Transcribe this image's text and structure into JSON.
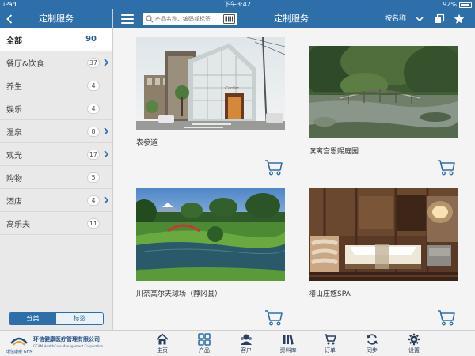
{
  "status": {
    "device": "iPad",
    "time": "下午3:42",
    "battery": "92%",
    "battery_level": 0.92
  },
  "sidebar": {
    "title": "定制服务",
    "categories": [
      {
        "label": "全部",
        "count": "90",
        "active": true,
        "has_arrow": false
      },
      {
        "label": "餐厅&饮食",
        "count": "37",
        "has_arrow": true
      },
      {
        "label": "养生",
        "count": "4",
        "has_arrow": false
      },
      {
        "label": "娱乐",
        "count": "4",
        "has_arrow": false
      },
      {
        "label": "温泉",
        "count": "8",
        "has_arrow": true
      },
      {
        "label": "观光",
        "count": "17",
        "has_arrow": true
      },
      {
        "label": "购物",
        "count": "5",
        "has_arrow": false
      },
      {
        "label": "酒店",
        "count": "4",
        "has_arrow": true
      },
      {
        "label": "高乐夫",
        "count": "11",
        "has_arrow": false
      }
    ],
    "segment": {
      "left": "分类",
      "right": "标签"
    }
  },
  "header": {
    "title": "定制服务",
    "search_placeholder": "产品名称、编码或标签",
    "sort_label": "按名称"
  },
  "products": [
    {
      "name": "表参道",
      "image": "building-photo"
    },
    {
      "name": "滨离宫恩赐庭园",
      "image": "garden-photo"
    },
    {
      "name": "川奈高尔夫球场（静冈县）",
      "image": "golf-photo"
    },
    {
      "name": "椿山庄悠SPA",
      "image": "spa-photo"
    }
  ],
  "tabbar": {
    "logo_cn": "环信健康医疗管理有限公司",
    "logo_en": "GCAM HealthCare Management Corporation",
    "logo_brand": "環信康療 GHM",
    "tabs": [
      {
        "label": "主页",
        "icon": "home-icon"
      },
      {
        "label": "产品",
        "icon": "grid-icon"
      },
      {
        "label": "客户",
        "icon": "customer-icon"
      },
      {
        "label": "资料库",
        "icon": "library-icon"
      },
      {
        "label": "订单",
        "icon": "cart-icon"
      },
      {
        "label": "同步",
        "icon": "sync-icon"
      },
      {
        "label": "设置",
        "icon": "gear-icon"
      }
    ]
  },
  "colors": {
    "primary": "#2f6fa9",
    "accent": "#2a5f92",
    "background": "#f3f3f3"
  }
}
